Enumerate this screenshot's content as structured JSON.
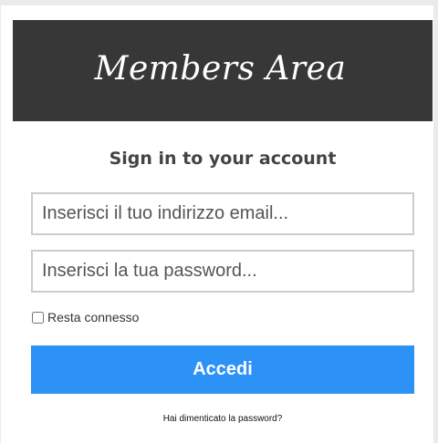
{
  "header": {
    "title": "Members Area"
  },
  "login": {
    "heading": "Sign in to your account",
    "email_placeholder": "Inserisci il tuo indirizzo email...",
    "email_value": "",
    "password_placeholder": "Inserisci la tua password...",
    "password_value": "",
    "remember_label": "Resta connesso",
    "remember_checked": false,
    "submit_label": "Accedi",
    "forgot_label": "Hai dimenticato la password?"
  },
  "colors": {
    "header_background": "#373737",
    "button_background": "#2d92f6",
    "page_background": "#ebebeb"
  }
}
